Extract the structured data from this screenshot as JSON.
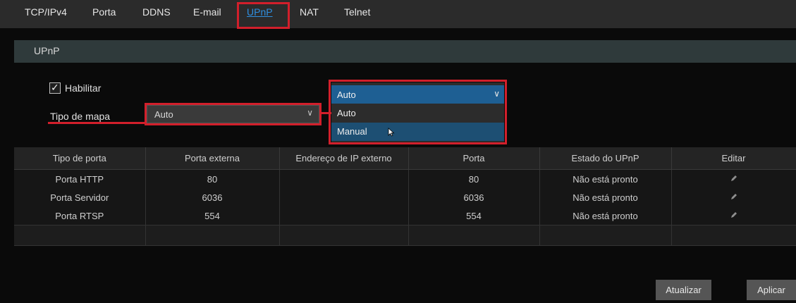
{
  "tabs": [
    "TCP/IPv4",
    "Porta",
    "DDNS",
    "E-mail",
    "UPnP",
    "NAT",
    "Telnet"
  ],
  "active_tab": "UPnP",
  "section": {
    "title": "UPnP"
  },
  "enable": {
    "label": "Habilitar",
    "checked": true
  },
  "map_type": {
    "label": "Tipo de mapa",
    "value": "Auto",
    "dropdown": {
      "selected": "Auto",
      "options": [
        "Auto",
        "Manual"
      ],
      "hovered": "Manual"
    }
  },
  "table": {
    "headers": [
      "Tipo de porta",
      "Porta externa",
      "Endereço de IP externo",
      "Porta",
      "Estado do UPnP",
      "Editar"
    ],
    "rows": [
      [
        "Porta HTTP",
        "80",
        "",
        "80",
        "Não está pronto",
        "pencil-icon"
      ],
      [
        "Porta Servidor",
        "6036",
        "",
        "6036",
        "Não está pronto",
        "pencil-icon"
      ],
      [
        "Porta RTSP",
        "554",
        "",
        "554",
        "Não está pronto",
        "pencil-icon"
      ]
    ]
  },
  "buttons": {
    "refresh": "Atualizar",
    "apply": "Aplicar"
  },
  "colors": {
    "highlight": "#d21f2b",
    "active_tab": "#2f8fe0",
    "dropdown_selected": "#1e5f93"
  }
}
